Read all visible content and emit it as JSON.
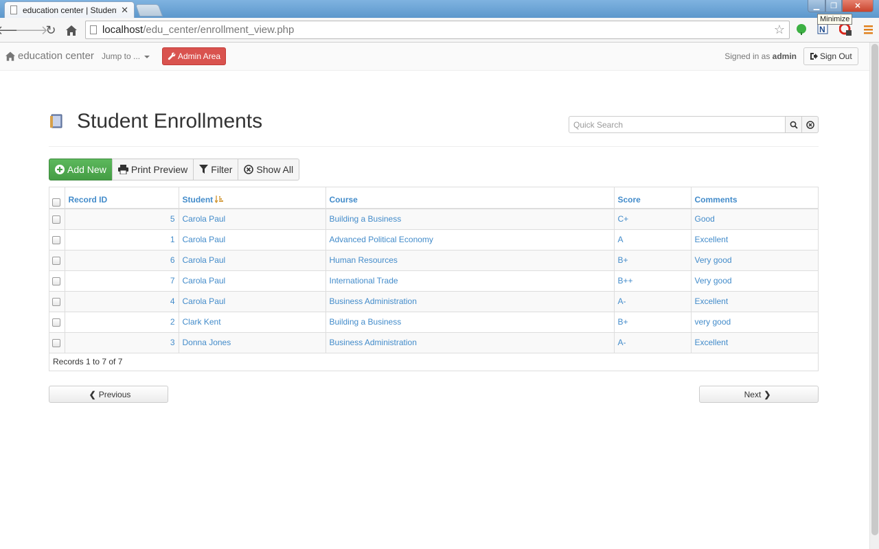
{
  "browser": {
    "tab_title": "education center | Student Enrollments",
    "url_host": "localhost",
    "url_path": "/edu_center/enrollment_view.php",
    "tooltip": "Minimize"
  },
  "navbar": {
    "brand": "education center",
    "jump_to": "Jump to ...",
    "admin_area": "Admin Area",
    "signed_in_prefix": "Signed in as",
    "signed_in_user": "admin",
    "sign_out": "Sign Out"
  },
  "page": {
    "title": "Student Enrollments",
    "search_placeholder": "Quick Search"
  },
  "actions": {
    "add_new": "Add New",
    "print_preview": "Print Preview",
    "filter": "Filter",
    "show_all": "Show All"
  },
  "table": {
    "columns": [
      "Record ID",
      "Student",
      "Course",
      "Score",
      "Comments"
    ],
    "rows": [
      {
        "id": "5",
        "student": "Carola Paul",
        "course": "Building a Business",
        "score": "C+",
        "comments": "Good"
      },
      {
        "id": "1",
        "student": "Carola Paul",
        "course": "Advanced Political Economy",
        "score": "A",
        "comments": "Excellent"
      },
      {
        "id": "6",
        "student": "Carola Paul",
        "course": "Human Resources",
        "score": "B+",
        "comments": "Very good"
      },
      {
        "id": "7",
        "student": "Carola Paul",
        "course": "International Trade",
        "score": "B++",
        "comments": "Very good"
      },
      {
        "id": "4",
        "student": "Carola Paul",
        "course": "Business Administration",
        "score": "A-",
        "comments": "Excellent"
      },
      {
        "id": "2",
        "student": "Clark Kent",
        "course": "Building a Business",
        "score": "B+",
        "comments": "very good"
      },
      {
        "id": "3",
        "student": "Donna Jones",
        "course": "Business Administration",
        "score": "A-",
        "comments": "Excellent"
      }
    ],
    "footer": "Records 1 to 7 of 7"
  },
  "pager": {
    "previous": "Previous",
    "next": "Next"
  },
  "colors": {
    "link": "#428bca",
    "success": "#5cb85c",
    "danger": "#d9534f"
  }
}
